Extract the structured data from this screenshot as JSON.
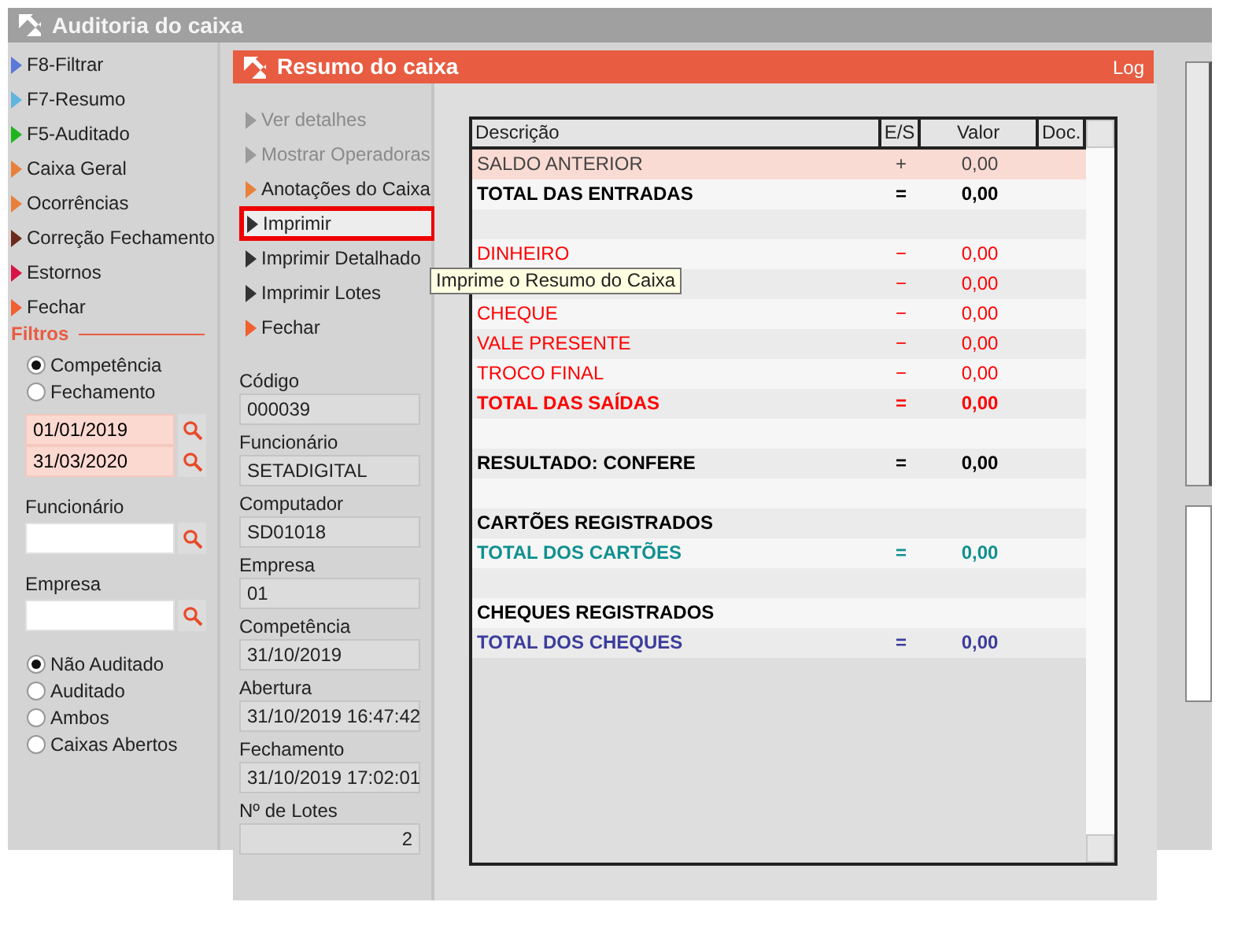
{
  "main_window": {
    "title": "Auditoria do caixa",
    "sidebar": {
      "items": [
        {
          "label": "F8-Filtrar",
          "color": "#5a78d8"
        },
        {
          "label": "F7-Resumo",
          "color": "#5fb4e0"
        },
        {
          "label": "F5-Auditado",
          "color": "#1fb41f"
        },
        {
          "label": "Caixa Geral",
          "color": "#e8803c"
        },
        {
          "label": "Ocorrências",
          "color": "#e8803c"
        },
        {
          "label": "Correção Fechamento",
          "color": "#6b2a1a"
        },
        {
          "label": "Estornos",
          "color": "#d81446"
        },
        {
          "label": "Fechar",
          "color": "#f06030"
        }
      ]
    },
    "filters": {
      "title": "Filtros",
      "date_type": [
        {
          "label": "Competência",
          "selected": true
        },
        {
          "label": "Fechamento",
          "selected": false
        }
      ],
      "date_from": "01/01/2019",
      "date_to": "31/03/2020",
      "employee_label": "Funcionário",
      "company_label": "Empresa",
      "status": [
        {
          "label": "Não Auditado",
          "selected": true
        },
        {
          "label": "Auditado",
          "selected": false
        },
        {
          "label": "Ambos",
          "selected": false
        },
        {
          "label": "Caixas Abertos",
          "selected": false
        }
      ]
    }
  },
  "dialog": {
    "title": "Resumo do caixa",
    "log_link": "Log",
    "actions": [
      {
        "label": "Ver detalhes",
        "color": "#9a9a9a",
        "disabled": true,
        "selected": false
      },
      {
        "label": "Mostrar Operadoras",
        "color": "#9a9a9a",
        "disabled": true,
        "selected": false
      },
      {
        "label": "Anotações do Caixa",
        "color": "#e8803c",
        "disabled": false,
        "selected": false
      },
      {
        "label": "Imprimir",
        "color": "#333333",
        "disabled": false,
        "selected": true
      },
      {
        "label": "Imprimir Detalhado",
        "color": "#333333",
        "disabled": false,
        "selected": false
      },
      {
        "label": "Imprimir Lotes",
        "color": "#333333",
        "disabled": false,
        "selected": false
      },
      {
        "label": "Fechar",
        "color": "#f06030",
        "disabled": false,
        "selected": false
      }
    ],
    "fields": [
      {
        "label": "Código",
        "value": "000039",
        "kind": "text"
      },
      {
        "label": "Funcionário",
        "value": "SETADIGITAL",
        "kind": "text"
      },
      {
        "label": "Computador",
        "value": "SD01018",
        "kind": "text"
      },
      {
        "label": "Empresa",
        "value": "01",
        "kind": "text"
      },
      {
        "label": "Competência",
        "value": "31/10/2019",
        "kind": "text"
      },
      {
        "label": "Abertura",
        "value": "31/10/2019 16:47:42",
        "kind": "text"
      },
      {
        "label": "Fechamento",
        "value": "31/10/2019 17:02:01",
        "kind": "text"
      },
      {
        "label": "Nº de Lotes",
        "value": "2",
        "kind": "number"
      }
    ],
    "table": {
      "columns": [
        "Descrição",
        "E/S",
        "Valor",
        "Doc."
      ],
      "rows": [
        {
          "kind": "item",
          "description": "SALDO ANTERIOR",
          "sign": "+",
          "value": "0,00",
          "color": "#444444",
          "selected": true
        },
        {
          "kind": "total",
          "description": "TOTAL DAS ENTRADAS",
          "sign": "=",
          "value": "0,00",
          "color": "#000000",
          "selected": false
        },
        {
          "kind": "blank",
          "selected": false
        },
        {
          "kind": "item",
          "description": "DINHEIRO",
          "sign": "−",
          "value": "0,00",
          "color": "#ff0000",
          "selected": false
        },
        {
          "kind": "item",
          "sign": "−",
          "value": "0,00",
          "color": "#ff0000",
          "selected": false
        },
        {
          "kind": "item",
          "description": "CHEQUE",
          "sign": "−",
          "value": "0,00",
          "color": "#ff0000",
          "selected": false
        },
        {
          "kind": "item",
          "description": "VALE PRESENTE",
          "sign": "−",
          "value": "0,00",
          "color": "#ff0000",
          "selected": false
        },
        {
          "kind": "item",
          "description": "TROCO FINAL",
          "sign": "−",
          "value": "0,00",
          "color": "#ff0000",
          "selected": false
        },
        {
          "kind": "total",
          "description": "TOTAL DAS SAÍDAS",
          "sign": "=",
          "value": "0,00",
          "color": "#ff0000",
          "selected": false
        },
        {
          "kind": "blank",
          "selected": false
        },
        {
          "kind": "total",
          "description": "RESULTADO: CONFERE",
          "sign": "=",
          "value": "0,00",
          "color": "#000000",
          "selected": false
        },
        {
          "kind": "blank",
          "selected": false
        },
        {
          "kind": "heading",
          "description": "CARTÕES REGISTRADOS",
          "color": "#000000",
          "selected": false
        },
        {
          "kind": "total",
          "description": "TOTAL DOS CARTÕES",
          "sign": "=",
          "value": "0,00",
          "color": "#109090",
          "selected": false
        },
        {
          "kind": "blank",
          "selected": false
        },
        {
          "kind": "heading",
          "description": "CHEQUES REGISTRADOS",
          "color": "#000000",
          "selected": false
        },
        {
          "kind": "total",
          "description": "TOTAL DOS CHEQUES",
          "sign": "=",
          "value": "0,00",
          "color": "#3c3c9c",
          "selected": false
        }
      ]
    },
    "tooltip": "Imprime o Resumo do Caixa"
  }
}
